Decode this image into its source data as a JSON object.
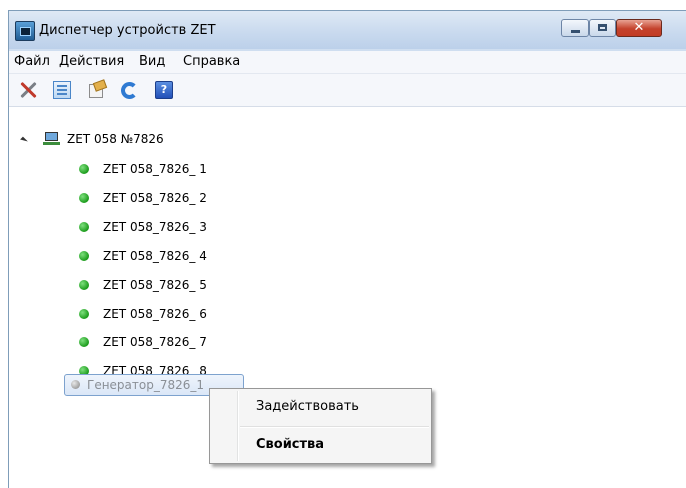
{
  "window": {
    "title": "Диспетчер устройств ZET",
    "close_glyph": "✕"
  },
  "menu": [
    "Файл",
    "Действия",
    "Вид",
    "Справка"
  ],
  "toolbar": {
    "icons": [
      "tools-icon",
      "device-list-icon",
      "properties-icon",
      "refresh-icon",
      "help-icon"
    ],
    "help_glyph": "?"
  },
  "tree": {
    "root_label": "ZET 058 №7826",
    "nodes": [
      {
        "label": "ZET 058_7826_ 1",
        "status": "online"
      },
      {
        "label": "ZET 058_7826_ 2",
        "status": "online"
      },
      {
        "label": "ZET 058_7826_ 3",
        "status": "online"
      },
      {
        "label": "ZET 058_7826_ 4",
        "status": "online"
      },
      {
        "label": "ZET 058_7826_ 5",
        "status": "online"
      },
      {
        "label": "ZET 058_7826_ 6",
        "status": "online"
      },
      {
        "label": "ZET 058_7826_ 7",
        "status": "online"
      },
      {
        "label": "ZET 058_7826_ 8",
        "status": "online"
      }
    ],
    "generator_label": "Генератор_7826_1"
  },
  "context_menu": {
    "items": [
      "Задействовать",
      "Свойства"
    ]
  },
  "colors": {
    "status_online": "#1b9b1b",
    "status_disabled": "#9a9a9a",
    "close_button": "#c4422c",
    "selection_border": "#7da2ce"
  }
}
